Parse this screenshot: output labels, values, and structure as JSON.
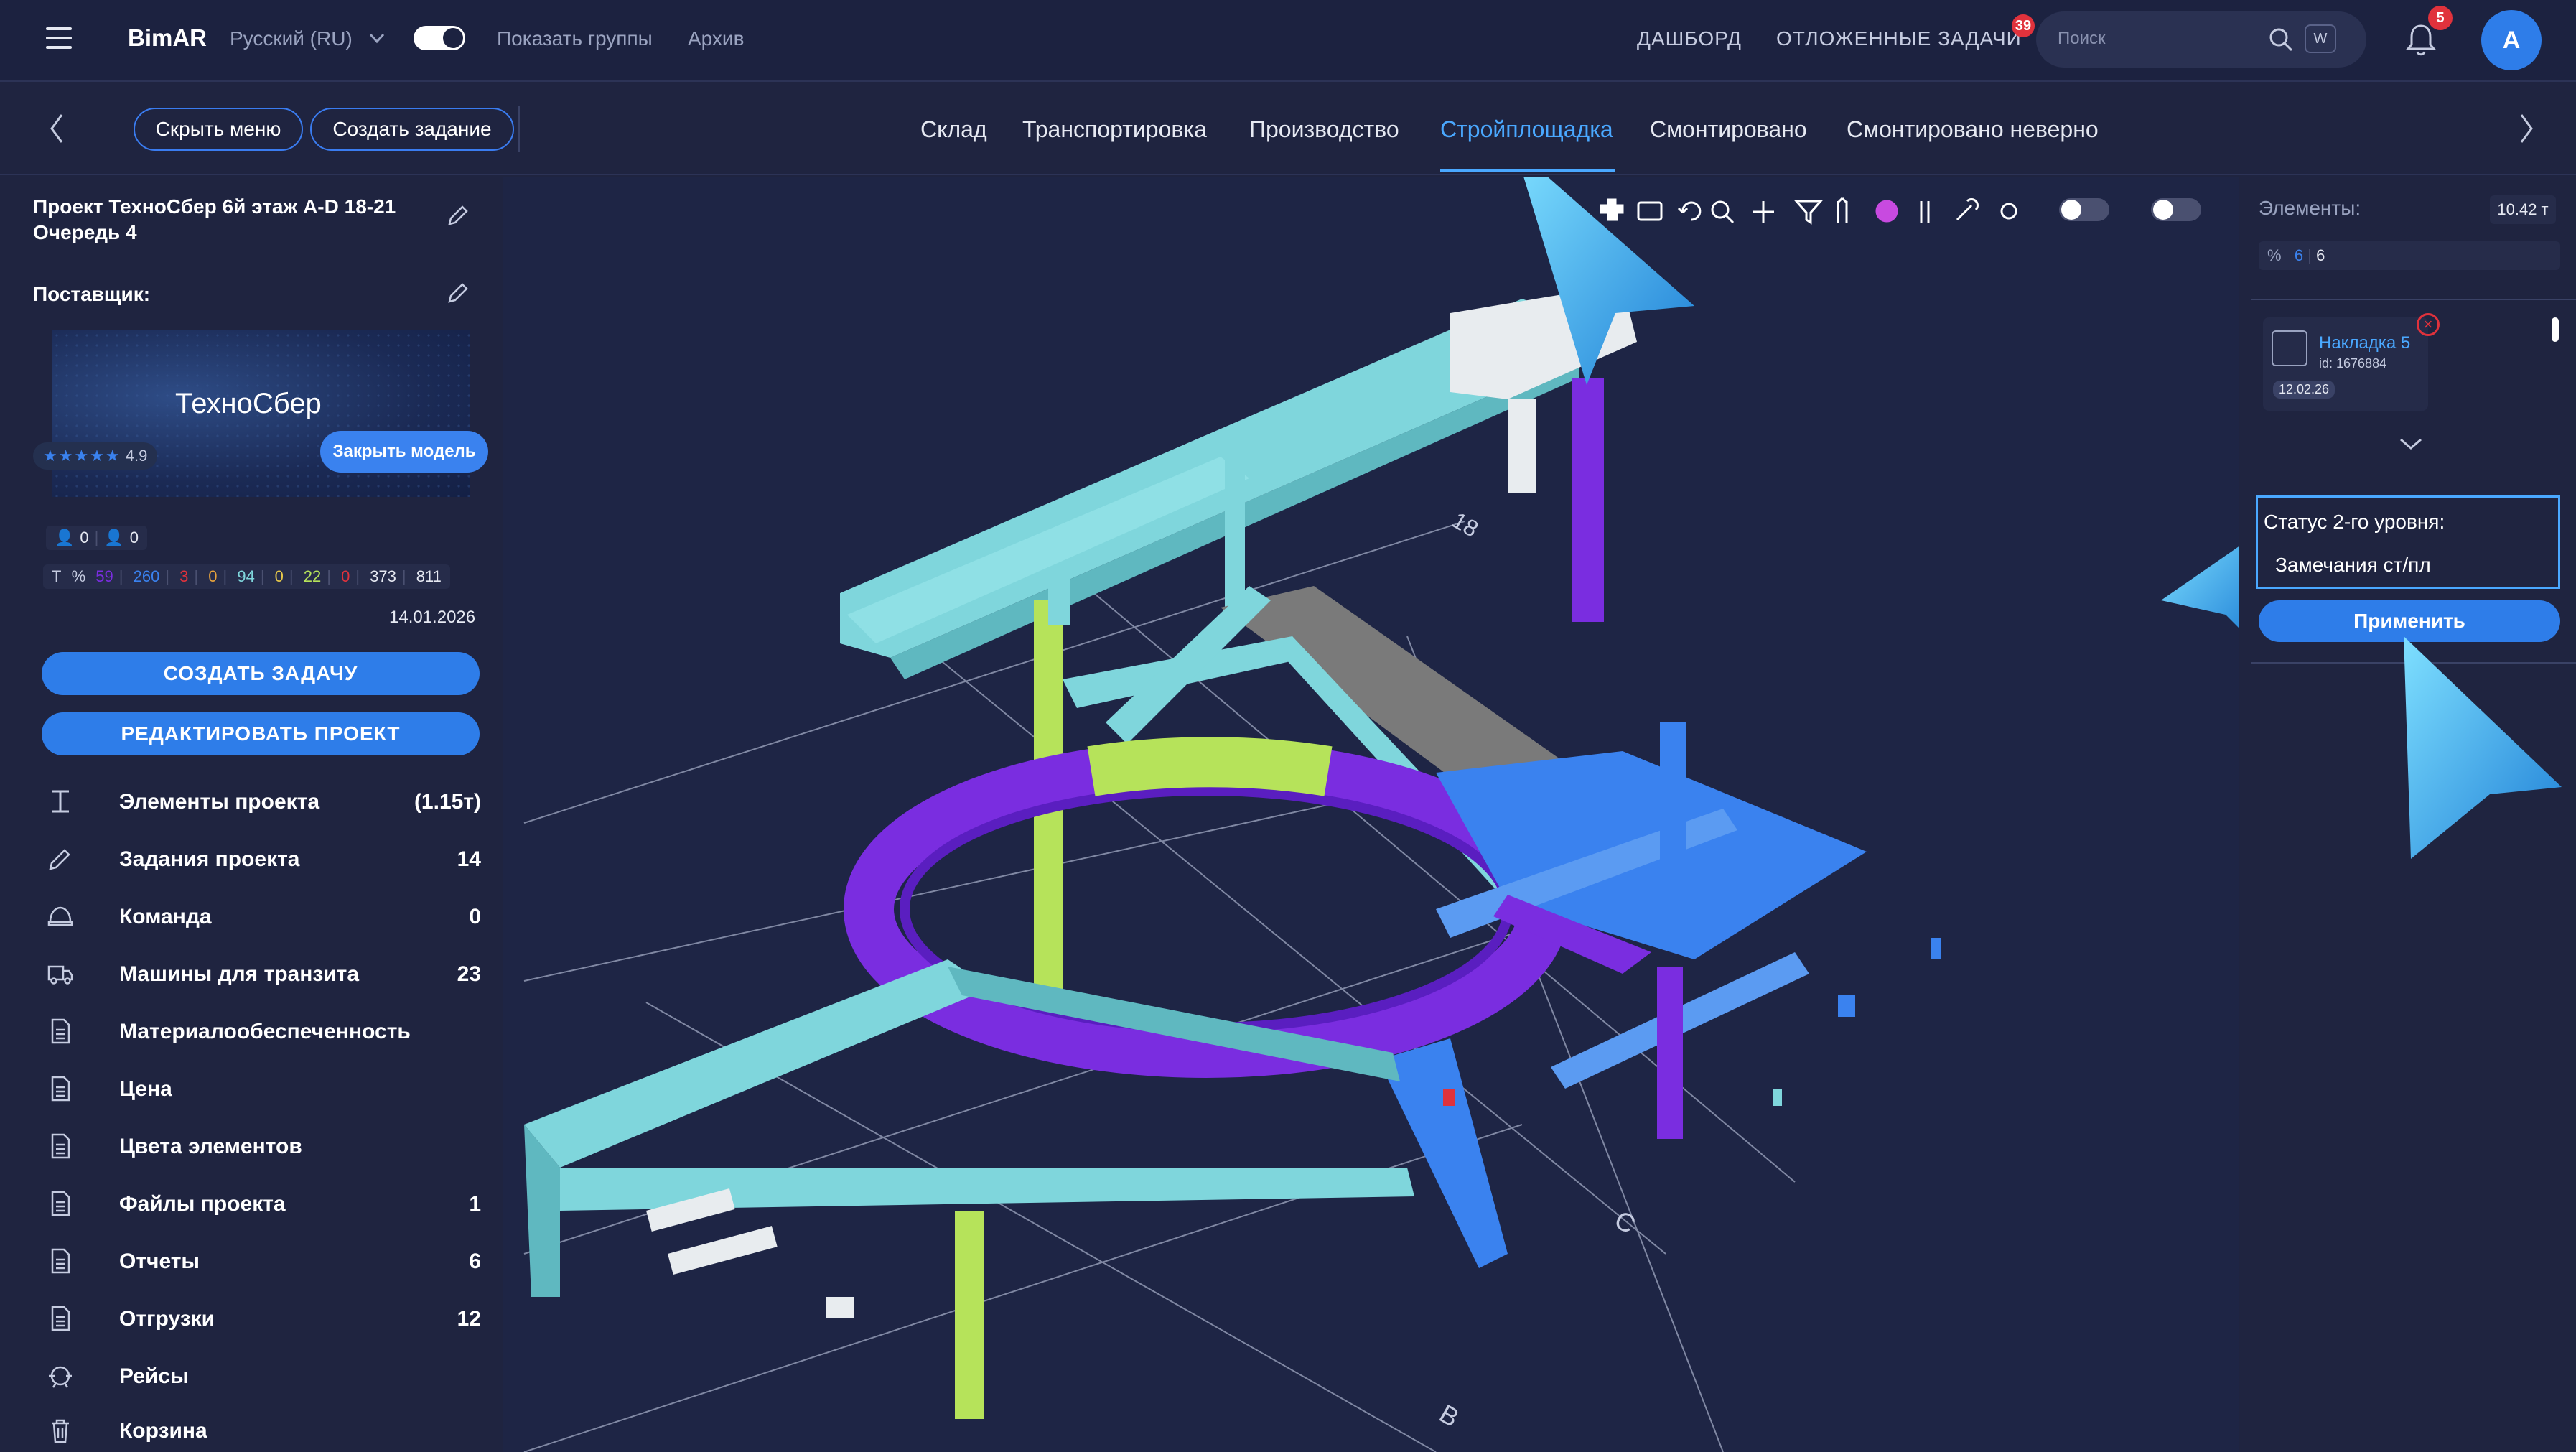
{
  "app": {
    "brand": "BimAR",
    "language": "Русский (RU)"
  },
  "topbar": {
    "show_groups": "Показать группы",
    "archive": "Архив",
    "dashboard": "ДАШБОРД",
    "deferred_tasks": "ОТЛОЖЕННЫЕ ЗАДАЧИ",
    "deferred_badge": "39",
    "search_placeholder": "Поиск",
    "search_key": "W",
    "notifications_badge": "5",
    "avatar_letter": "A"
  },
  "subbar": {
    "hide_menu": "Скрыть меню",
    "create_task": "Создать задание",
    "tabs": [
      "Склад",
      "Транспортировка",
      "Производство",
      "Стройплощадка",
      "Смонтировано",
      "Смонтировано неверно"
    ],
    "active_tab": "Стройплощадка"
  },
  "left": {
    "project_title": "Проект ТехноСбер 6й этаж A-D 18-21 Очередь 4",
    "supplier_label": "Поставщик:",
    "supplier_name": "ТехноСбер",
    "rating_stars": "★★★★★",
    "rating_value": "4.9",
    "close_model": "Закрыть модель",
    "users": {
      "a": "0",
      "b": "0"
    },
    "stats": {
      "t": "T",
      "pct": "%",
      "v1": "59",
      "v2": "260",
      "v3": "3",
      "v4": "0",
      "v5": "94",
      "v6": "0",
      "v7": "22",
      "v8": "0",
      "v9": "373",
      "v10": "811"
    },
    "date": "14.01.2026",
    "create_task_btn": "СОЗДАТЬ ЗАДАЧУ",
    "edit_project_btn": "РЕДАКТИРОВАТЬ ПРОЕКТ",
    "menu": [
      {
        "label": "Элементы проекта",
        "count": "(1.15т)"
      },
      {
        "label": "Задания проекта",
        "count": "14"
      },
      {
        "label": "Команда",
        "count": "0"
      },
      {
        "label": "Машины для транзита",
        "count": "23"
      },
      {
        "label": "Материалообеспеченность",
        "count": ""
      },
      {
        "label": "Цена",
        "count": ""
      },
      {
        "label": "Цвета элементов",
        "count": ""
      },
      {
        "label": "Файлы проекта",
        "count": "1"
      },
      {
        "label": "Отчеты",
        "count": "6"
      },
      {
        "label": "Отгрузки",
        "count": "12"
      },
      {
        "label": "Рейсы",
        "count": ""
      },
      {
        "label": "Корзина",
        "count": ""
      }
    ]
  },
  "viewport": {
    "grid_labels": {
      "a": "18",
      "b": "C",
      "c": "B"
    }
  },
  "right": {
    "elements_label": "Элементы:",
    "weight": "10.42 т",
    "pct_label": "%",
    "pct_a": "6",
    "pct_b": "6",
    "card_title": "Накладка 5",
    "card_id": "id: 1676884",
    "card_date": "12.02.26",
    "status_title": "Статус 2-го уровня:",
    "status_value": "Замечания ст/пл",
    "apply": "Применить"
  },
  "colors": {
    "accent": "#2e7de9",
    "link": "#4aa8ff",
    "cyan_member": "#7fd6dc",
    "purple_member": "#7a2de0",
    "blue_member": "#3a82ef",
    "lime_member": "#b6e35a",
    "gray_member": "#7a7a7a",
    "badge": "#e0323c"
  }
}
